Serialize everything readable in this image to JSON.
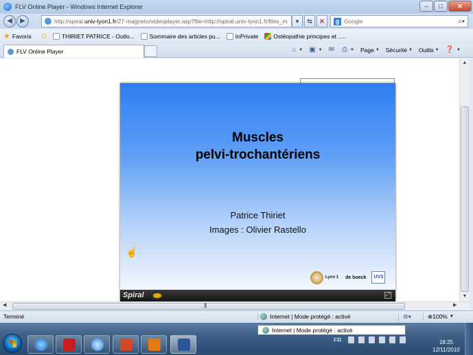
{
  "window": {
    "title": "FLV Online Player - Windows Internet Explorer",
    "min_label": "–",
    "max_label": "□",
    "close_label": "✕"
  },
  "address": {
    "url_prefix": "http://spiral.",
    "url_domain": "univ-lyon1.fr",
    "url_rest": "/27-magneto/videoplayer.asp?file=http://spiral.univ-lyon1.fr/files_m/",
    "search_placeholder": "Google"
  },
  "favorites": {
    "favoris_label": "Favoris",
    "items": [
      "THIRIET PATRICE - Outlo...",
      "Sommaire des articles pu...",
      "InPrivate",
      "Ostéopathie principes et ....."
    ]
  },
  "tabs": {
    "active": "FLV Online Player"
  },
  "commandbar": {
    "page": "Page",
    "securite": "Sécurité",
    "outils": "Outils"
  },
  "slide": {
    "title_line1": "Muscles",
    "title_line2": "pelvi-trochantériens",
    "author": "Patrice Thiriet",
    "images": "Images : Olivier Rastello",
    "logo_lyon1": "Lyon 1",
    "logo_deboeck": "de boeck",
    "logo_uvs": "UVS",
    "player_brand": "Spiral"
  },
  "status": {
    "left": "Terminé",
    "zone": "Internet | Mode protégé : activé",
    "zoom": "100%"
  },
  "taskbar": {
    "tooltip": "Internet | Mode protégé : activé",
    "lang": "FR",
    "time": "18:25",
    "date": "12/11/2010"
  }
}
